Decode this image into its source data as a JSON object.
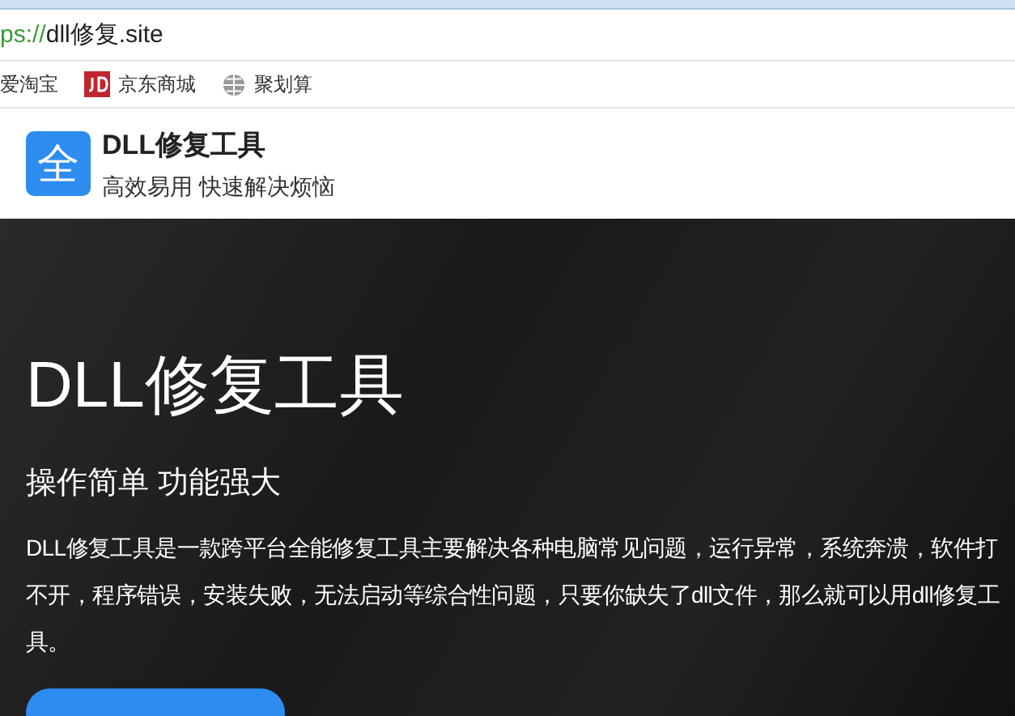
{
  "address_bar": {
    "scheme": "ps://",
    "host": "dll修复.site"
  },
  "bookmarks": [
    {
      "label": "爱淘宝",
      "kind": "plain"
    },
    {
      "label": "京东商城",
      "kind": "jd"
    },
    {
      "label": "聚划算",
      "kind": "globe"
    }
  ],
  "site_header": {
    "logo": "全",
    "title": "DLL修复工具",
    "tagline": "高效易用 快速解决烦恼"
  },
  "hero": {
    "title": "DLL修复工具",
    "subtitle": "操作简单 功能强大",
    "description": "DLL修复工具是一款跨平台全能修复工具主要解决各种电脑常见问题，运行异常，系统奔溃，软件打不开，程序错误，安装失败，无法启动等综合性问题，只要你缺失了dll文件，那么就可以用dll修复工具。"
  }
}
